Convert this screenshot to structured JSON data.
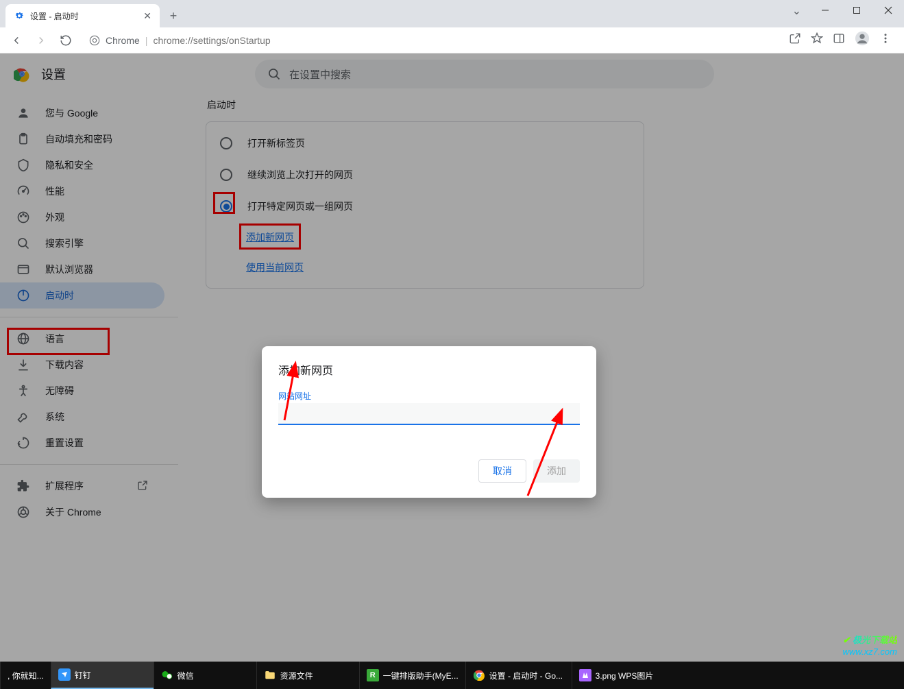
{
  "window": {
    "tab_title": "设置 - 启动时",
    "chevron": "⌄"
  },
  "address": {
    "scheme_label": "Chrome",
    "url_display": "chrome://settings/onStartup"
  },
  "settings": {
    "title": "设置",
    "search_placeholder": "在设置中搜索",
    "sidebar": [
      {
        "icon": "person",
        "label": "您与 Google"
      },
      {
        "icon": "clipboard",
        "label": "自动填充和密码"
      },
      {
        "icon": "shield",
        "label": "隐私和安全"
      },
      {
        "icon": "speed",
        "label": "性能"
      },
      {
        "icon": "palette",
        "label": "外观"
      },
      {
        "icon": "search",
        "label": "搜索引擎"
      },
      {
        "icon": "browser",
        "label": "默认浏览器"
      },
      {
        "icon": "power",
        "label": "启动时",
        "active": true
      }
    ],
    "sidebar2": [
      {
        "icon": "globe",
        "label": "语言"
      },
      {
        "icon": "download",
        "label": "下载内容"
      },
      {
        "icon": "accessibility",
        "label": "无障碍"
      },
      {
        "icon": "wrench",
        "label": "系统"
      },
      {
        "icon": "reset",
        "label": "重置设置"
      }
    ],
    "sidebar3": [
      {
        "icon": "puzzle",
        "label": "扩展程序",
        "external": true
      },
      {
        "icon": "chrome",
        "label": "关于 Chrome"
      }
    ]
  },
  "onStartup": {
    "section_title": "启动时",
    "options": [
      {
        "label": "打开新标签页",
        "checked": false
      },
      {
        "label": "继续浏览上次打开的网页",
        "checked": false
      },
      {
        "label": "打开特定网页或一组网页",
        "checked": true
      }
    ],
    "links": {
      "add_new": "添加新网页",
      "use_current": "使用当前网页"
    }
  },
  "dialog": {
    "title": "添加新网页",
    "input_label": "网站网址",
    "input_value": "",
    "cancel": "取消",
    "add": "添加"
  },
  "taskbar": {
    "items": [
      {
        "label": ", 你就知...",
        "color": "#101010"
      },
      {
        "label": "钉钉",
        "color": "#3296fa",
        "active": true
      },
      {
        "label": "微信",
        "color": "#1aad19"
      },
      {
        "label": "资源文件",
        "color": "#f8d776"
      },
      {
        "label": "一键排版助手(MyE...",
        "color": "#39a939"
      },
      {
        "label": "设置 - 启动时 - Go...",
        "color": "#fff"
      },
      {
        "label": "3.png  WPS图片",
        "color": "#a865ff"
      }
    ]
  },
  "watermark": {
    "line1": "极光下载站",
    "line2": "www.xz7.com"
  }
}
